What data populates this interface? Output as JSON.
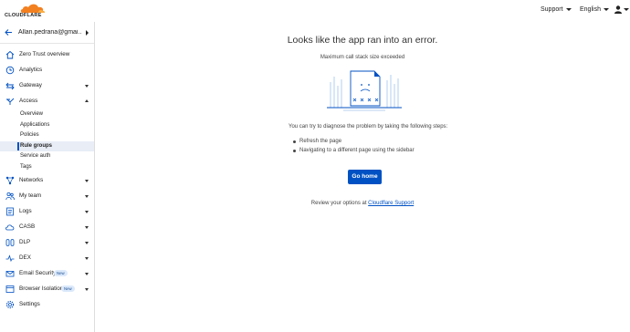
{
  "topbar": {
    "logo_text": "CLOUDFLARE",
    "support_label": "Support",
    "language_label": "English",
    "user_icon": "user-icon"
  },
  "sidebar": {
    "account_name": "Allan.pedrana@gmai...",
    "items": [
      {
        "label": "Zero Trust overview",
        "icon": "home-icon"
      },
      {
        "label": "Analytics",
        "icon": "clock-icon"
      },
      {
        "label": "Gateway",
        "icon": "gateway-icon"
      },
      {
        "label": "Access",
        "icon": "access-icon"
      },
      {
        "label": "Networks",
        "icon": "networks-icon"
      },
      {
        "label": "My team",
        "icon": "team-icon"
      },
      {
        "label": "Logs",
        "icon": "logs-icon"
      },
      {
        "label": "CASB",
        "icon": "casb-icon"
      },
      {
        "label": "DLP",
        "icon": "dlp-icon"
      },
      {
        "label": "DEX",
        "icon": "dex-icon"
      },
      {
        "label": "Email Security",
        "icon": "mail-icon",
        "badge": "New"
      },
      {
        "label": "Browser Isolation",
        "icon": "browser-icon",
        "badge": "New"
      },
      {
        "label": "Settings",
        "icon": "gear-icon"
      }
    ],
    "access_subitems": [
      "Overview",
      "Applications",
      "Policies",
      "Rule groups",
      "Service auth",
      "Tags"
    ],
    "active_subitem": "Rule groups"
  },
  "main": {
    "title": "Looks like the app ran into an error.",
    "message": "Maximum call stack size exceeded",
    "help_text": "You can try to diagnose the problem by taking the following steps:",
    "steps": [
      "Refresh the page",
      "Navigating to a different page using the sidebar"
    ],
    "go_home_label": "Go home",
    "review_prefix": "Review your options at ",
    "review_link": "Cloudflare Support"
  },
  "colors": {
    "accent": "#0051c3",
    "brand_orange": "#f38020",
    "active_bg": "#e8edf6"
  }
}
